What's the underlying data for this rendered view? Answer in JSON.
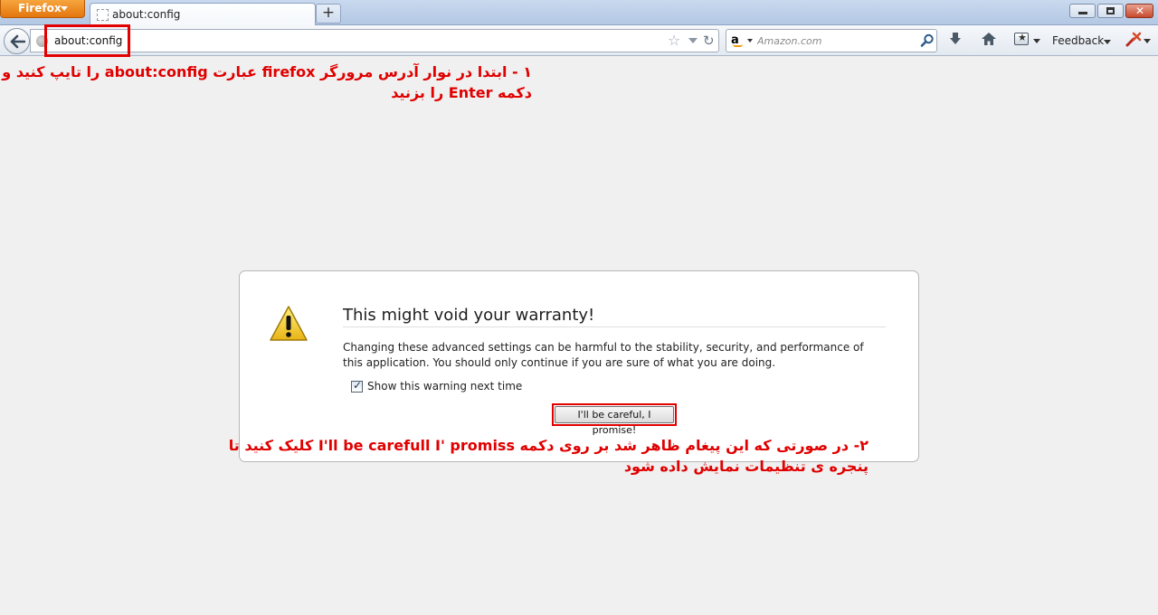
{
  "browser": {
    "app_menu_label": "Firefox",
    "tab_title": "about:config",
    "new_tab_label": "+",
    "url": "about:config",
    "search_placeholder": "Amazon.com",
    "feedback_label": "Feedback"
  },
  "dialog": {
    "title": "This might void your warranty!",
    "body": "Changing these advanced settings can be harmful to the stability, security, and performance of this application. You should only continue if you are sure of what you are doing.",
    "checkbox_label": "Show this warning next time",
    "checkbox_checked": true,
    "confirm_button_label": "I'll be careful, I promise!"
  },
  "annotations": {
    "step1_line1": "۱ - ابتدا در نوار آدرس مرورگر firefox عبارت about:config را تایپ کنید و",
    "step1_line2": "دکمه Enter را بزنید",
    "step2_line1": "۲- در صورتی که این پیغام ظاهر شد بر روی دکمه I'll be carefull I' promiss کلیک کنید تا",
    "step2_line2": "پنجره ی تنظیمات نمایش داده شود",
    "color": "#e00000"
  },
  "colors": {
    "firefox_button": "#e4760e",
    "highlight": "#e30000",
    "page_background": "#f0f0f0"
  }
}
